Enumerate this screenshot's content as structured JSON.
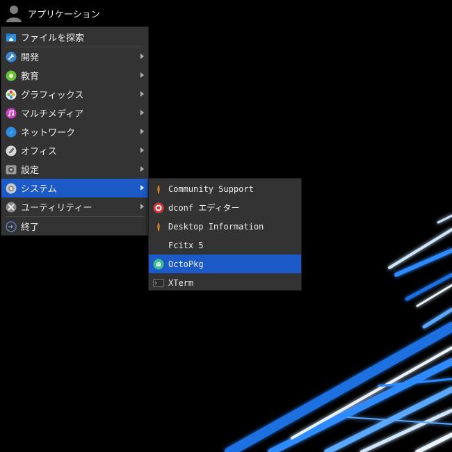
{
  "panel": {
    "applications_label": "アプリケーション"
  },
  "main_menu": {
    "items": [
      {
        "label": "ファイルを探索",
        "icon": "folder-home-icon"
      },
      {
        "label": "開発",
        "icon": "development-icon"
      },
      {
        "label": "教育",
        "icon": "education-icon"
      },
      {
        "label": "グラフィックス",
        "icon": "graphics-icon"
      },
      {
        "label": "マルチメディア",
        "icon": "multimedia-icon"
      },
      {
        "label": "ネットワーク",
        "icon": "network-icon"
      },
      {
        "label": "オフィス",
        "icon": "office-icon"
      },
      {
        "label": "設定",
        "icon": "settings-icon"
      },
      {
        "label": "システム",
        "icon": "system-icon"
      },
      {
        "label": "ユーティリティー",
        "icon": "utilities-icon"
      },
      {
        "label": "終了",
        "icon": "logout-icon"
      }
    ]
  },
  "system_submenu": {
    "items": [
      {
        "label": "Community Support",
        "icon": "rocket-icon"
      },
      {
        "label": "dconf エディター",
        "icon": "dconf-icon"
      },
      {
        "label": "Desktop Information",
        "icon": "rocket-icon"
      },
      {
        "label": "Fcitx 5",
        "icon": ""
      },
      {
        "label": "OctoPkg",
        "icon": "octopkg-icon"
      },
      {
        "label": "XTerm",
        "icon": "terminal-icon"
      }
    ]
  },
  "colors": {
    "menu_bg": "#333333",
    "highlight": "#1c5bc7",
    "text": "#ececec",
    "wallpaper_glow": "#2f8bff"
  }
}
